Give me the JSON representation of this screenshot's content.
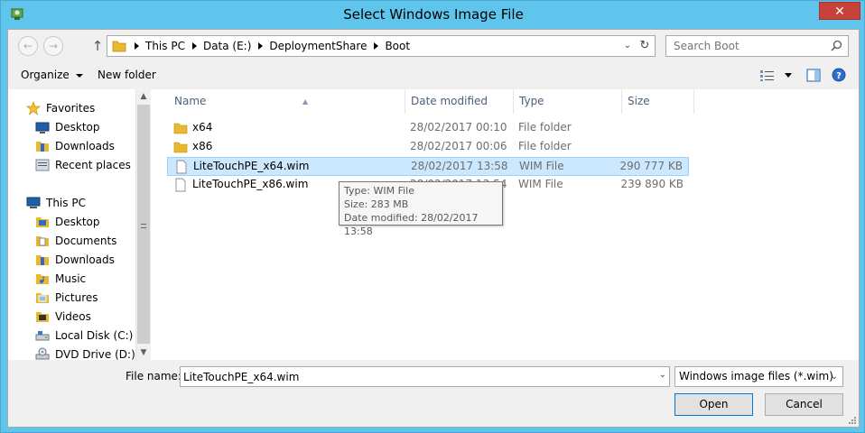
{
  "window": {
    "title": "Select Windows Image File",
    "close_glyph": "✕"
  },
  "address": {
    "crumbs": [
      "This PC",
      "Data (E:)",
      "DeploymentShare",
      "Boot"
    ],
    "dropdown_glyph": "⌄",
    "refresh_glyph": "↻"
  },
  "nav_buttons": {
    "back_glyph": "←",
    "forward_glyph": "→",
    "up_glyph": "↑"
  },
  "search": {
    "placeholder": "Search Boot"
  },
  "toolbar": {
    "organize_label": "Organize",
    "new_folder_label": "New folder"
  },
  "nav_pane": {
    "favorites_label": "Favorites",
    "favorites": [
      {
        "label": "Desktop",
        "icon": "desktop-icon"
      },
      {
        "label": "Downloads",
        "icon": "downloads-icon"
      },
      {
        "label": "Recent places",
        "icon": "recent-places-icon"
      }
    ],
    "this_pc_label": "This PC",
    "this_pc": [
      {
        "label": "Desktop",
        "icon": "desktop-folder-icon"
      },
      {
        "label": "Documents",
        "icon": "documents-icon"
      },
      {
        "label": "Downloads",
        "icon": "downloads-icon"
      },
      {
        "label": "Music",
        "icon": "music-icon"
      },
      {
        "label": "Pictures",
        "icon": "pictures-icon"
      },
      {
        "label": "Videos",
        "icon": "videos-icon"
      },
      {
        "label": "Local Disk (C:)",
        "icon": "local-disk-icon"
      },
      {
        "label": "DVD Drive (D:) IR",
        "icon": "dvd-drive-icon"
      }
    ]
  },
  "file_list": {
    "columns": [
      "Name",
      "Date modified",
      "Type",
      "Size"
    ],
    "rows": [
      {
        "name": "x64",
        "date": "28/02/2017 00:10",
        "type": "File folder",
        "size": "",
        "icon": "folder-icon"
      },
      {
        "name": "x86",
        "date": "28/02/2017 00:06",
        "type": "File folder",
        "size": "",
        "icon": "folder-icon"
      },
      {
        "name": "LiteTouchPE_x64.wim",
        "date": "28/02/2017 13:58",
        "type": "WIM File",
        "size": "290 777 KB",
        "icon": "file-icon",
        "selected": true
      },
      {
        "name": "LiteTouchPE_x86.wim",
        "date": "28/02/2017 13:54",
        "type": "WIM File",
        "size": "239 890 KB",
        "icon": "file-icon"
      }
    ]
  },
  "tooltip": {
    "type_line": "Type: WIM File",
    "size_line": "Size: 283 MB",
    "date_line": "Date modified: 28/02/2017 13:58"
  },
  "bottom": {
    "file_name_label": "File name:",
    "file_name_value": "LiteTouchPE_x64.wim",
    "file_type_value": "Windows image files (*.wim)",
    "open_label": "Open",
    "cancel_label": "Cancel"
  },
  "colors": {
    "title_bar": "#5fc5ec",
    "selection": "#cce8ff",
    "selection_border": "#99d1ff",
    "close_button": "#c7423a",
    "folder": "#e8b830"
  }
}
